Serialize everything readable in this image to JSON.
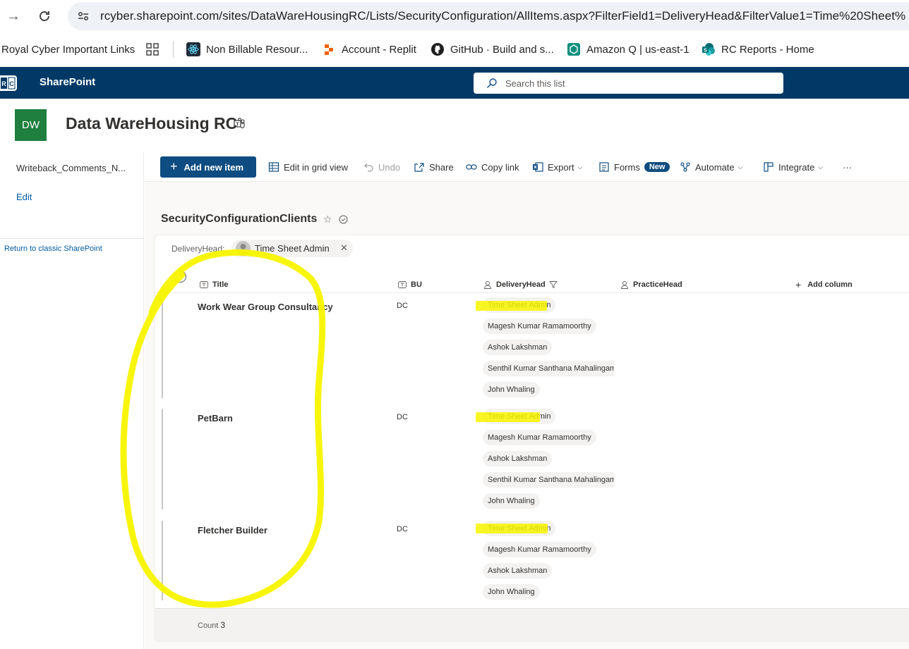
{
  "browser": {
    "url": "rcyber.sharepoint.com/sites/DataWareHousingRC/Lists/SecurityConfiguration/AllItems.aspx?FilterField1=DeliveryHead&FilterValue1=Time%20Sheet%"
  },
  "bookmarks": [
    {
      "label": "Royal Cyber Important Links"
    },
    {
      "label": "Non Billable Resour..."
    },
    {
      "label": "Account - Replit"
    },
    {
      "label": "GitHub · Build and s..."
    },
    {
      "label": "Amazon Q | us-east-1"
    },
    {
      "label": "RC Reports - Home"
    }
  ],
  "suite": {
    "logo_text": "RC",
    "app_name": "SharePoint",
    "search_placeholder": "Search this list"
  },
  "site": {
    "logo_initials": "DW",
    "title": "Data WareHousing RC"
  },
  "leftnav": {
    "item": "Writeback_Comments_N...",
    "edit": "Edit",
    "classic": "Return to classic SharePoint"
  },
  "commands": {
    "add_new": "Add new item",
    "grid": "Edit in grid view",
    "undo": "Undo",
    "share": "Share",
    "copy_link": "Copy link",
    "export": "Export",
    "forms": "Forms",
    "forms_badge": "New",
    "automate": "Automate",
    "integrate": "Integrate",
    "more": "···"
  },
  "list": {
    "title": "SecurityConfigurationClients",
    "filter_label": "DeliveryHead:",
    "filter_value": "Time Sheet Admin",
    "columns": {
      "title": "Title",
      "bu": "BU",
      "delivery_head": "DeliveryHead",
      "practice_head": "PracticeHead",
      "add_column": "Add column"
    },
    "rows": [
      {
        "title": "Work Wear Group Consultancy",
        "bu": "DC",
        "delivery_heads": [
          "Time Sheet Admin",
          "Magesh Kumar Ramamoorthy",
          "Ashok Lakshman",
          "Senthil Kumar Santhana Mahalingam",
          "John Whaling"
        ]
      },
      {
        "title": "PetBarn",
        "bu": "DC",
        "delivery_heads": [
          "Time Sheet Admin",
          "Magesh Kumar Ramamoorthy",
          "Ashok Lakshman",
          "Senthil Kumar Santhana Mahalingam",
          "John Whaling"
        ]
      },
      {
        "title": "Fletcher Builder",
        "bu": "DC",
        "delivery_heads": [
          "Time Sheet Admin",
          "Magesh Kumar Ramamoorthy",
          "Ashok Lakshman",
          "John Whaling"
        ]
      }
    ],
    "count_label": "Count",
    "count_value": "3"
  },
  "colors": {
    "suite_bar": "#003966",
    "primary_button": "#0f4c81",
    "site_logo": "#1e7f3e",
    "annotation": "#f8f400"
  }
}
